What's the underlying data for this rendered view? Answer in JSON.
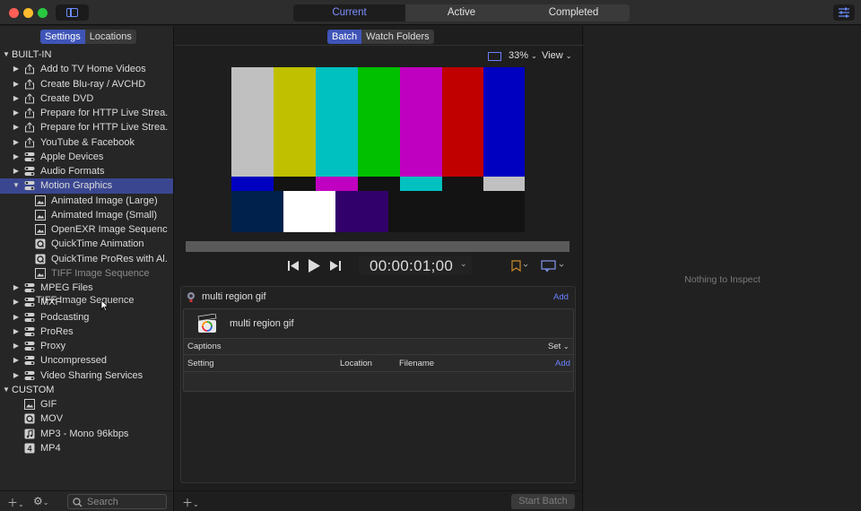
{
  "window": {
    "tabs": [
      {
        "label": "Current"
      },
      {
        "label": "Active"
      },
      {
        "label": "Completed"
      }
    ]
  },
  "sidebar": {
    "segments": [
      {
        "label": "Settings"
      },
      {
        "label": "Locations"
      }
    ],
    "sections": {
      "builtin": "BUILT-IN",
      "custom": "CUSTOM"
    },
    "builtin_items": [
      {
        "label": "Add to TV Home Videos",
        "icon": "share-icon"
      },
      {
        "label": "Create Blu-ray / AVCHD",
        "icon": "share-icon"
      },
      {
        "label": "Create DVD",
        "icon": "share-icon"
      },
      {
        "label": "Prepare for HTTP Live Strea...",
        "icon": "share-icon"
      },
      {
        "label": "Prepare for HTTP Live Strea...",
        "icon": "share-icon"
      },
      {
        "label": "YouTube & Facebook",
        "icon": "share-icon"
      },
      {
        "label": "Apple Devices",
        "icon": "toggle-icon"
      },
      {
        "label": "Audio Formats",
        "icon": "toggle-icon"
      },
      {
        "label": "Motion Graphics",
        "icon": "toggle-icon"
      }
    ],
    "motion_children": [
      {
        "label": "Animated Image (Large)",
        "icon": "image-icon"
      },
      {
        "label": "Animated Image (Small)",
        "icon": "image-icon"
      },
      {
        "label": "OpenEXR Image Sequence",
        "icon": "image-icon"
      },
      {
        "label": "QuickTime Animation",
        "icon": "quicktime-icon"
      },
      {
        "label": "QuickTime ProRes with Al...",
        "icon": "quicktime-icon"
      },
      {
        "label": "TIFF Image Sequence",
        "icon": "image-icon"
      }
    ],
    "builtin_items_after": [
      {
        "label": "MPEG Files",
        "icon": "toggle-icon"
      },
      {
        "label": "MXF",
        "icon": "toggle-icon"
      },
      {
        "label": "Podcasting",
        "icon": "toggle-icon"
      },
      {
        "label": "ProRes",
        "icon": "toggle-icon"
      },
      {
        "label": "Proxy",
        "icon": "toggle-icon"
      },
      {
        "label": "Uncompressed",
        "icon": "toggle-icon"
      },
      {
        "label": "Video Sharing Services",
        "icon": "toggle-icon"
      }
    ],
    "custom_items": [
      {
        "label": "GIF",
        "icon": "image-icon"
      },
      {
        "label": "MOV",
        "icon": "quicktime-icon"
      },
      {
        "label": "MP3 - Mono 96kbps",
        "icon": "music-icon"
      },
      {
        "label": "MP4",
        "icon": "mp4-icon"
      }
    ],
    "drag_ghost": "TIFF Image Sequence",
    "search_placeholder": "Search"
  },
  "center": {
    "segments": [
      {
        "label": "Batch"
      },
      {
        "label": "Watch Folders"
      }
    ],
    "zoom": "33%",
    "view_label": "View",
    "timecode": "00:00:01;00",
    "batch": {
      "title": "multi region gif",
      "add_label": "Add",
      "job_name": "multi region gif",
      "captions_label": "Captions",
      "set_label": "Set",
      "columns": {
        "setting": "Setting",
        "location": "Location",
        "filename": "Filename"
      },
      "add_label_2": "Add"
    },
    "start_batch": "Start Batch"
  },
  "inspector": {
    "empty_text": "Nothing to Inspect"
  },
  "colors": {
    "accent": "#3f55b8",
    "link": "#6b80ff",
    "selection": "#3a4790"
  }
}
